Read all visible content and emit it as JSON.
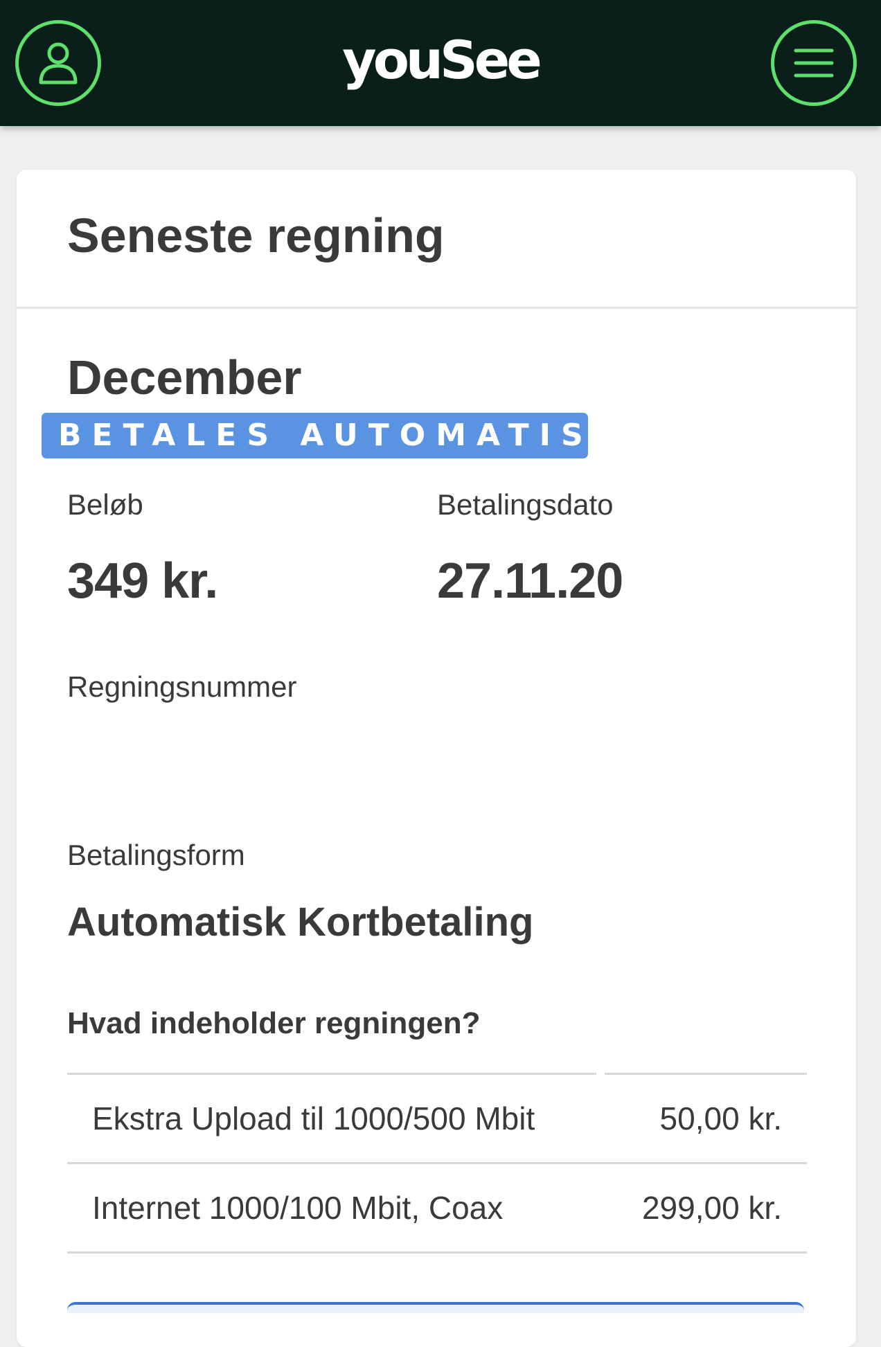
{
  "header": {
    "logo_text": "youSee",
    "profile_icon": "user-icon",
    "menu_icon": "hamburger-menu-icon",
    "accent_color": "#5ee06d",
    "background_color": "#0b1f1a"
  },
  "invoice": {
    "card_title": "Seneste regning",
    "month": "December",
    "status_badge": "BETALES AUTOMATISK",
    "status_color": "#5b93e3",
    "amount_label": "Beløb",
    "amount_value": "349 kr.",
    "payment_date_label": "Betalingsdato",
    "payment_date_value": "27.11.20",
    "invoice_number_label": "Regningsnummer",
    "invoice_number_value": "",
    "payment_method_label": "Betalingsform",
    "payment_method_value": "Automatisk Kortbetaling",
    "contents_heading": "Hvad indeholder regningen?",
    "line_items": [
      {
        "description": "Ekstra Upload til 1000/500 Mbit",
        "amount": "50,00 kr."
      },
      {
        "description": "Internet 1000/100 Mbit, Coax",
        "amount": "299,00 kr."
      }
    ]
  }
}
